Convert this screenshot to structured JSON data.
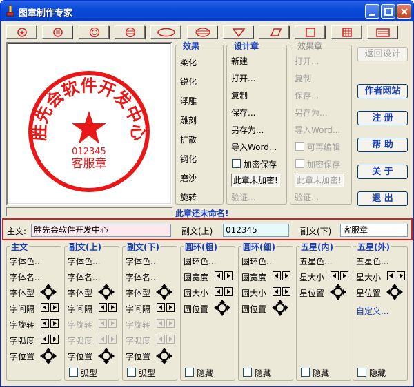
{
  "window": {
    "title": "图章制作专家"
  },
  "stamp": {
    "arc_text": "胜先会软件开发中心",
    "number": "012345",
    "bottom_text": "客服章",
    "color": "#e81818"
  },
  "effects": {
    "title": "效果",
    "items": [
      "柔化",
      "锐化",
      "浮雕",
      "雕刻",
      "扩散",
      "钢化",
      "磨沙",
      "旋转"
    ]
  },
  "design": {
    "title": "设计章",
    "new": "新建",
    "open": "打开...",
    "copy": "复制",
    "save": "保存...",
    "save_as": "另存为...",
    "import": "导入Word...",
    "encrypt": "加密保存",
    "status": "此章未加密!",
    "verify": "验证..."
  },
  "effect_stamp": {
    "title": "效果章",
    "open": "打开...",
    "copy": "复制",
    "save": "保存...",
    "save_as": "另存为...",
    "import": "导入Word...",
    "editable": "可再编辑",
    "encrypt": "加密保存",
    "status": "此章未加密!",
    "verify": "验证..."
  },
  "side": {
    "back": "返回设计",
    "site": "作者网站",
    "register": "注 册",
    "help": "帮 助",
    "about": "关 于",
    "exit": "退 出"
  },
  "unnamed": "此章还未命名!",
  "texts": {
    "main_label": "主文:",
    "main_value": "胜先会软件开发中心",
    "upper_label": "副文(上)",
    "upper_value": "012345",
    "lower_label": "副文(下)",
    "lower_value": "客服章"
  },
  "panels": [
    {
      "title": "主文",
      "rows": [
        "字体色...",
        "字体名...",
        "字体型",
        "字间隔",
        "字旋转",
        "字弧度",
        "字位置"
      ]
    },
    {
      "title": "副文(上)",
      "rows": [
        "字体色...",
        "字体名...",
        "字体型",
        "字间隔",
        "字旋转",
        "字弧度",
        "字位置"
      ],
      "check": "弧型"
    },
    {
      "title": "副文(下)",
      "rows": [
        "字体色...",
        "字体名...",
        "字体型",
        "字间隔",
        "字旋转",
        "字弧度",
        "字位置"
      ],
      "check": "弧型"
    },
    {
      "title": "圆环(粗)",
      "rows": [
        "圆环色...",
        "圆宽度",
        "圆大小",
        "圆位置"
      ],
      "check": "隐藏"
    },
    {
      "title": "圆环(细)",
      "rows": [
        "圆环色...",
        "圆宽度",
        "圆大小",
        "圆位置"
      ],
      "check": "隐藏"
    },
    {
      "title": "五星(内)",
      "rows": [
        "五星色...",
        "星大小",
        "星位置"
      ],
      "check": "隐藏"
    },
    {
      "title": "五星(外)",
      "rows": [
        "五星色...",
        "星大小",
        "星位置",
        "自定义..."
      ],
      "check": "隐藏"
    }
  ]
}
